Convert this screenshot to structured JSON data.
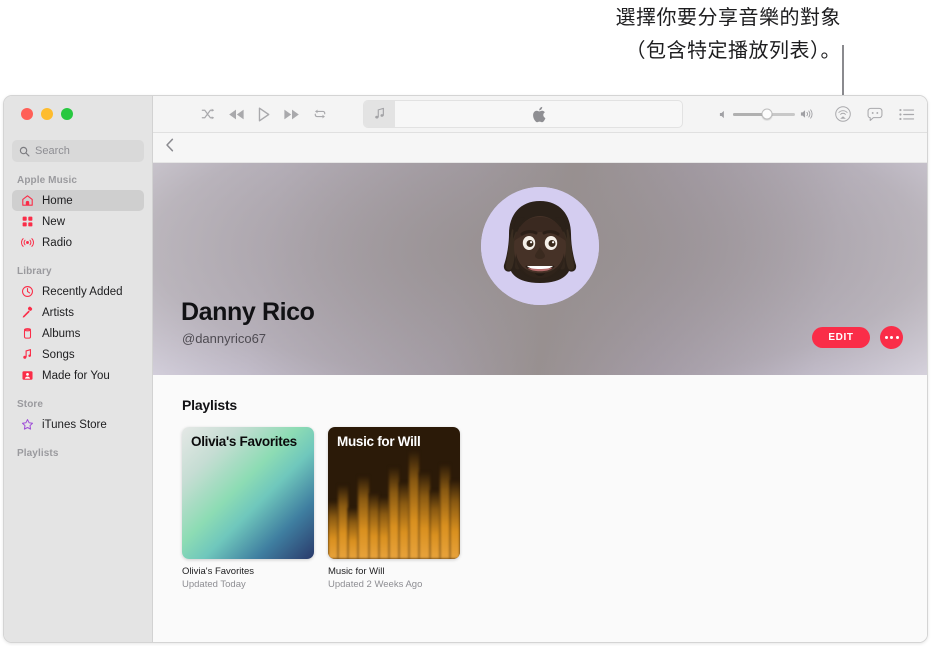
{
  "annotation": {
    "text": "選擇你要分享音樂的對象\n（包含特定播放列表）。"
  },
  "window": {
    "traffic_lights": [
      "close",
      "minimize",
      "zoom"
    ]
  },
  "sidebar": {
    "search": {
      "placeholder": "Search",
      "value": ""
    },
    "groups": [
      {
        "title": "Apple Music",
        "items": [
          {
            "label": "Home",
            "icon": "home-icon",
            "selected": true
          },
          {
            "label": "New",
            "icon": "grid-icon",
            "selected": false
          },
          {
            "label": "Radio",
            "icon": "radio-icon",
            "selected": false
          }
        ]
      },
      {
        "title": "Library",
        "items": [
          {
            "label": "Recently Added",
            "icon": "clock-icon",
            "selected": false
          },
          {
            "label": "Artists",
            "icon": "microphone-icon",
            "selected": false
          },
          {
            "label": "Albums",
            "icon": "album-icon",
            "selected": false
          },
          {
            "label": "Songs",
            "icon": "music-note-icon",
            "selected": false
          },
          {
            "label": "Made for You",
            "icon": "portrait-icon",
            "selected": false
          }
        ]
      },
      {
        "title": "Store",
        "items": [
          {
            "label": "iTunes Store",
            "icon": "star-icon",
            "selected": false
          }
        ]
      },
      {
        "title": "Playlists",
        "items": []
      }
    ]
  },
  "toolbar": {
    "transport": [
      "shuffle-icon",
      "rewind-icon",
      "play-icon",
      "fast-forward-icon",
      "repeat-icon"
    ],
    "now_playing": {
      "badge_icon": "music-note-icon",
      "content_icon": "apple-logo-icon",
      "text": ""
    },
    "volume": {
      "level": 55,
      "min_icon": "volume-low-icon",
      "max_icon": "volume-high-icon"
    },
    "right_icons": [
      "airplay-icon",
      "lyrics-icon",
      "queue-icon"
    ],
    "back_icon": "chevron-left-icon"
  },
  "profile": {
    "name": "Danny Rico",
    "handle": "@dannyrico67",
    "avatar_icon": "memoji-avatar",
    "edit_label": "EDIT",
    "more_label": "more-options"
  },
  "playlists_section": {
    "title": "Playlists",
    "items": [
      {
        "art_title": "Olivia's Favorites",
        "name": "Olivia's Favorites",
        "updated": "Updated Today"
      },
      {
        "art_title": "Music for Will",
        "name": "Music for Will",
        "updated": "Updated 2 Weeks Ago"
      }
    ]
  },
  "colors": {
    "accent_red": "#fa2d48",
    "sidebar_bg": "#e4e4e4",
    "star_purple": "#a050d8"
  }
}
